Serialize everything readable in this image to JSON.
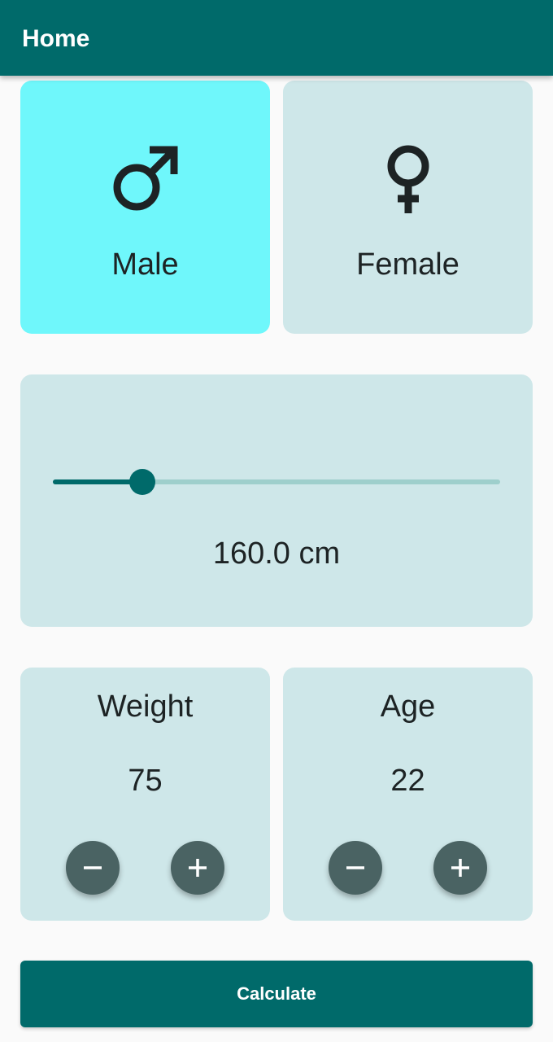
{
  "appbar": {
    "title": "Home"
  },
  "gender": {
    "male": {
      "label": "Male",
      "icon": "male-symbol-icon",
      "selected": true
    },
    "female": {
      "label": "Female",
      "icon": "female-symbol-icon",
      "selected": false
    }
  },
  "height": {
    "display": "160.0 cm",
    "slider_fraction": 0.2
  },
  "weight": {
    "label": "Weight",
    "value": "75",
    "decrement_icon": "minus-icon",
    "increment_icon": "plus-icon"
  },
  "age": {
    "label": "Age",
    "value": "22",
    "decrement_icon": "minus-icon",
    "increment_icon": "plus-icon"
  },
  "actions": {
    "calculate_label": "Calculate"
  },
  "colors": {
    "primary": "#006a6a",
    "card": "#cee7e9",
    "card_selected": "#6ff7fb",
    "fab": "#4a6363",
    "slider_inactive": "#9ecfcc"
  }
}
